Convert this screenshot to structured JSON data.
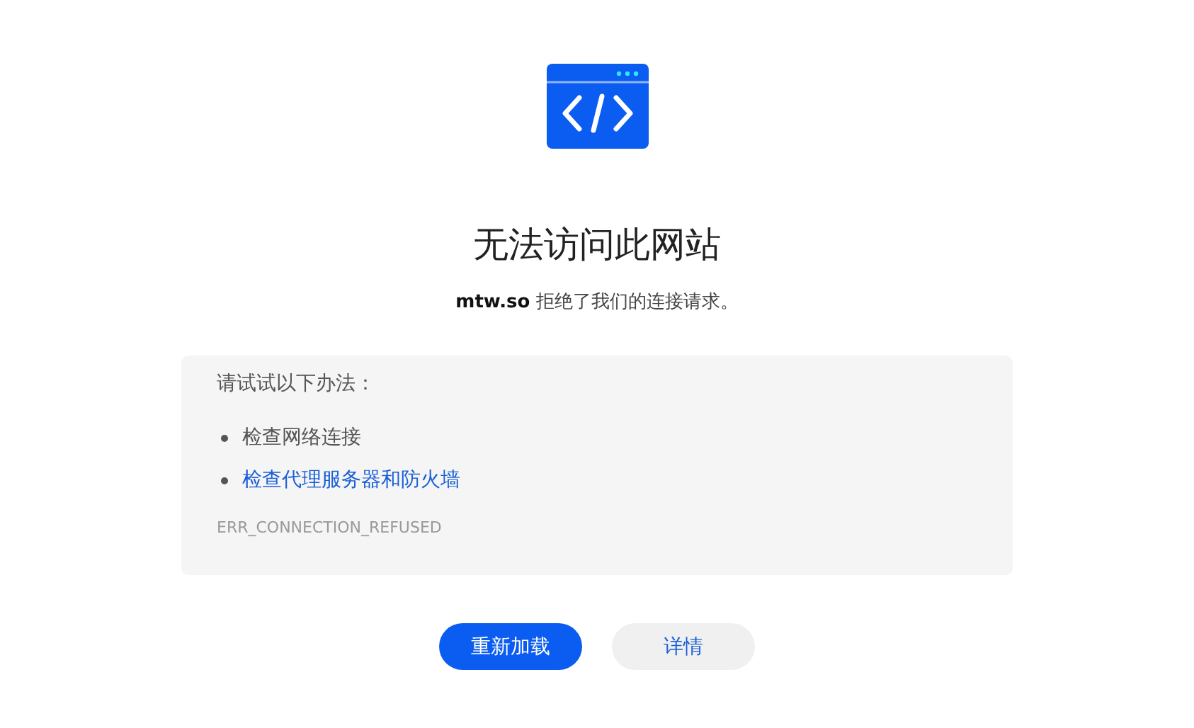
{
  "title": "无法访问此网站",
  "message": "**mtw.so** 拒绝了我们的连接请求。",
  "suggestions": {
    "heading": "请试试以下办法：",
    "items": [
      {
        "kind": "text",
        "label": "检查网络连接"
      },
      {
        "kind": "link",
        "label": "检查代理服务器和防火墙"
      }
    ],
    "error_code": "ERR_CONNECTION_REFUSED"
  },
  "buttons": [
    {
      "kind": "primary",
      "label": "重新加载"
    },
    {
      "kind": "secondary",
      "label": "详情"
    }
  ]
}
